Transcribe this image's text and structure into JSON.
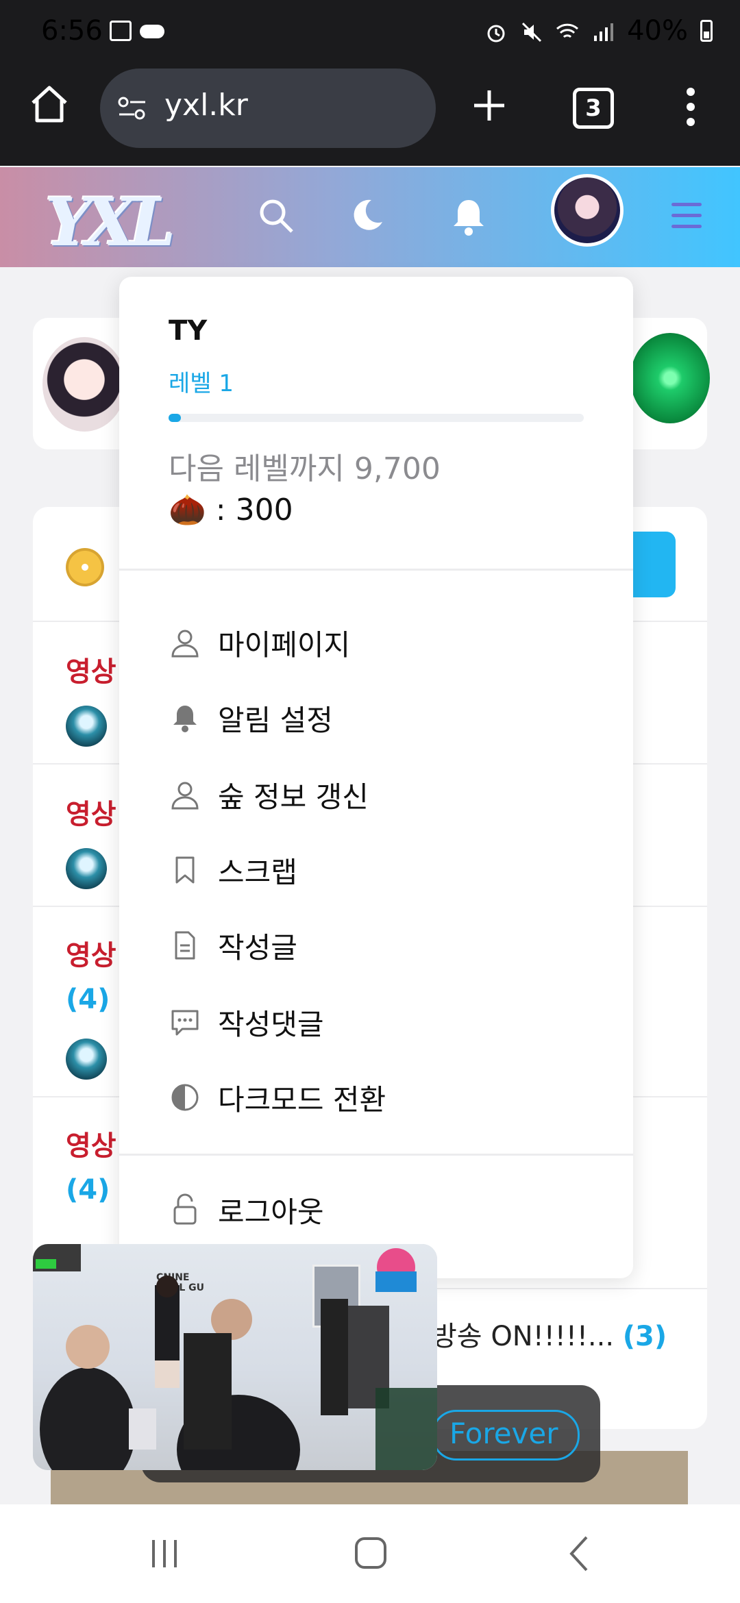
{
  "status_bar": {
    "time": "6:56",
    "battery": "40%"
  },
  "browser": {
    "url": "yxl.kr",
    "tab_count": "3"
  },
  "site": {
    "logo": "YXL"
  },
  "background": {
    "rows": [
      {
        "tag": "영상",
        "count": ""
      },
      {
        "tag": "영상",
        "count": ""
      },
      {
        "tag": "영상",
        "count": "(4)"
      },
      {
        "tag": "영상",
        "count": "(4)"
      }
    ],
    "row5_text": "방송 ON!!!!!...",
    "row5_count": "(3)"
  },
  "menu": {
    "name": "TY",
    "level": "레벨 1",
    "level_progress": 0.03,
    "next_level": "다음 레벨까지 9,700",
    "acorn": "🌰 : 300",
    "items": [
      {
        "label": "마이페이지",
        "icon": "user-icon"
      },
      {
        "label": "알림 설정",
        "icon": "bell-icon"
      },
      {
        "label": "숲 정보 갱신",
        "icon": "user-icon"
      },
      {
        "label": "스크랩",
        "icon": "bookmark-icon"
      },
      {
        "label": "작성글",
        "icon": "document-icon"
      },
      {
        "label": "작성댓글",
        "icon": "comment-icon"
      },
      {
        "label": "다크모드 전환",
        "icon": "contrast-icon"
      }
    ],
    "logout": "로그아웃"
  },
  "pip": {
    "brand": "CNINE\nCHUL GU"
  },
  "toast": {
    "label": "Forever"
  }
}
